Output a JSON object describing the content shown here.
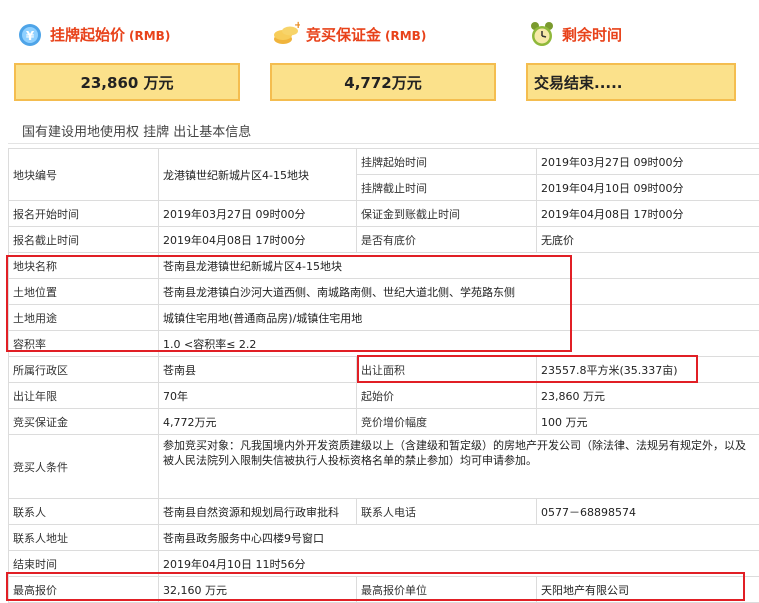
{
  "summary": {
    "start_price": {
      "title": "挂牌起始价",
      "unit": "(RMB)",
      "value": "23,860 万元",
      "icon": "money-bag-icon"
    },
    "deposit": {
      "title": "竞买保证金",
      "unit": "(RMB)",
      "value": "4,772万元",
      "icon": "gold-coin-icon"
    },
    "remaining": {
      "title": "剩余时间",
      "value": "交易结束.....",
      "icon": "alarm-clock-icon"
    }
  },
  "section_title": "国有建设用地使用权 挂牌 出让基本信息",
  "colors": {
    "title_red": "#e8421a",
    "box_fill": "#fbe18b",
    "box_border": "#f4bd4f",
    "highlight": "#e11f25"
  },
  "table": {
    "parcel_no": {
      "label": "地块编号",
      "value": "龙港镇世纪新城片区4-15地块"
    },
    "list_start": {
      "label": "挂牌起始时间",
      "value": "2019年03月27日 09时00分"
    },
    "list_end": {
      "label": "挂牌截止时间",
      "value": "2019年04月10日 09时00分"
    },
    "reg_start": {
      "label": "报名开始时间",
      "value": "2019年03月27日 09时00分"
    },
    "deposit_deadline": {
      "label": "保证金到账截止时间",
      "value": "2019年04月08日 17时00分"
    },
    "reg_end": {
      "label": "报名截止时间",
      "value": "2019年04月08日 17时00分"
    },
    "reserve": {
      "label": "是否有底价",
      "value": "无底价"
    },
    "parcel_name": {
      "label": "地块名称",
      "value": "苍南县龙港镇世纪新城片区4-15地块"
    },
    "location": {
      "label": "土地位置",
      "value": "苍南县龙港镇白沙河大道西侧、南城路南侧、世纪大道北侧、学苑路东侧"
    },
    "usage": {
      "label": "土地用途",
      "value": "城镇住宅用地(普通商品房)/城镇住宅用地"
    },
    "far": {
      "label": "容积率",
      "value": "1.0 <容积率≤ 2.2"
    },
    "district": {
      "label": "所属行政区",
      "value": "苍南县"
    },
    "area": {
      "label": "出让面积",
      "value": "23557.8平方米(35.337亩)"
    },
    "term": {
      "label": "出让年限",
      "value": "70年"
    },
    "start_price": {
      "label": "起始价",
      "value": "23,860 万元"
    },
    "deposit": {
      "label": "竞买保证金",
      "value": "4,772万元"
    },
    "increment": {
      "label": "竞价增价幅度",
      "value": "100 万元"
    },
    "bidder_cond": {
      "label": "竞买人条件",
      "value": "参加竞买对象：凡我国境内外开发资质建级以上（含建级和暂定级）的房地产开发公司（除法律、法规另有规定外，以及被人民法院列入限制失信被执行人投标资格名单的禁止参加）均可申请参加。"
    },
    "contact": {
      "label": "联系人",
      "value": "苍南县自然资源和规划局行政审批科"
    },
    "phone": {
      "label": "联系人电话",
      "value": "0577－68898574"
    },
    "address": {
      "label": "联系人地址",
      "value": "苍南县政务服务中心四楼9号窗口"
    },
    "end_time": {
      "label": "结束时间",
      "value": "2019年04月10日 11时56分"
    },
    "top_bid": {
      "label": "最高报价",
      "value": "32,160 万元"
    },
    "top_bidder": {
      "label": "最高报价单位",
      "value": "天阳地产有限公司"
    }
  }
}
